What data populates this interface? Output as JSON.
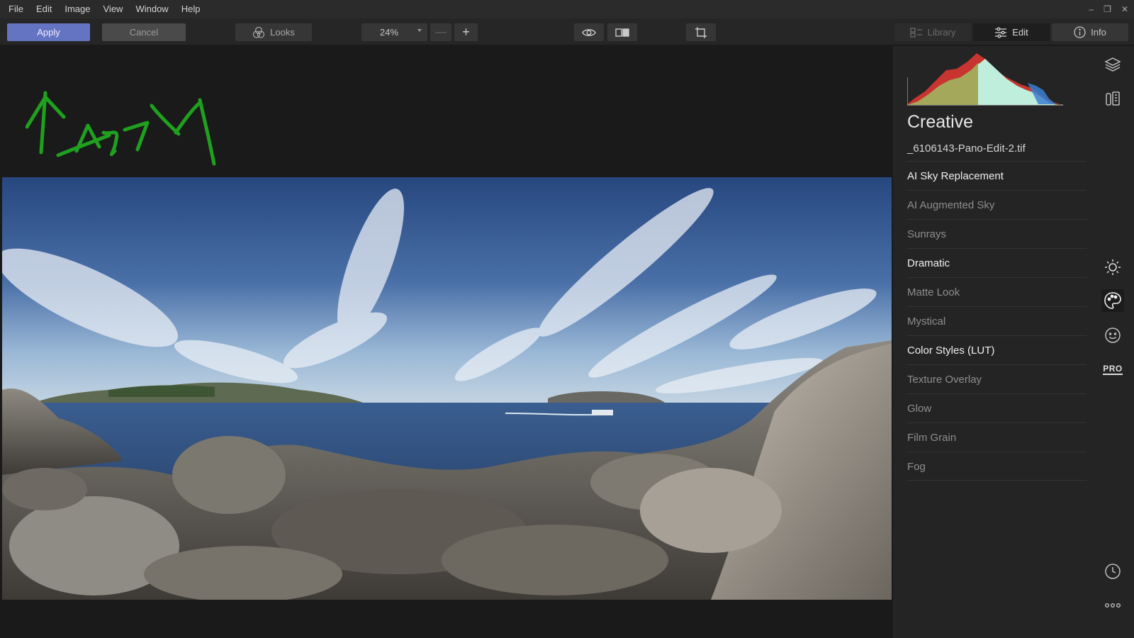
{
  "menu": {
    "items": [
      "File",
      "Edit",
      "Image",
      "View",
      "Window",
      "Help"
    ],
    "window_controls": [
      "–",
      "❐",
      "✕"
    ]
  },
  "toolbar": {
    "apply_label": "Apply",
    "cancel_label": "Cancel",
    "looks_label": "Looks",
    "zoom_value": "24%",
    "zoom_minus": "—",
    "zoom_plus": "+",
    "library_label": "Library",
    "edit_label": "Edit",
    "info_label": "Info"
  },
  "panel": {
    "title": "Creative",
    "file_name": "_6106143-Pano-Edit-2.tif",
    "tools": [
      {
        "label": "AI Sky Replacement",
        "active": true
      },
      {
        "label": "AI Augmented Sky",
        "active": false
      },
      {
        "label": "Sunrays",
        "active": false
      },
      {
        "label": "Dramatic",
        "active": true
      },
      {
        "label": "Matte Look",
        "active": false
      },
      {
        "label": "Mystical",
        "active": false
      },
      {
        "label": "Color Styles (LUT)",
        "active": true
      },
      {
        "label": "Texture Overlay",
        "active": false
      },
      {
        "label": "Glow",
        "active": false
      },
      {
        "label": "Film Grain",
        "active": false
      },
      {
        "label": "Fog",
        "active": false
      }
    ]
  },
  "rail": {
    "icons": [
      "layers-icon",
      "presets-icon",
      "sun-icon",
      "palette-icon",
      "face-icon",
      "pro-icon",
      "history-icon",
      "more-icon"
    ],
    "pro_label": "PRO"
  },
  "annotation_text": "Apply",
  "colors": {
    "accent": "#6574c2",
    "annotation": "#1fa01f",
    "background": "#1b1b1b",
    "panel": "#242424"
  }
}
